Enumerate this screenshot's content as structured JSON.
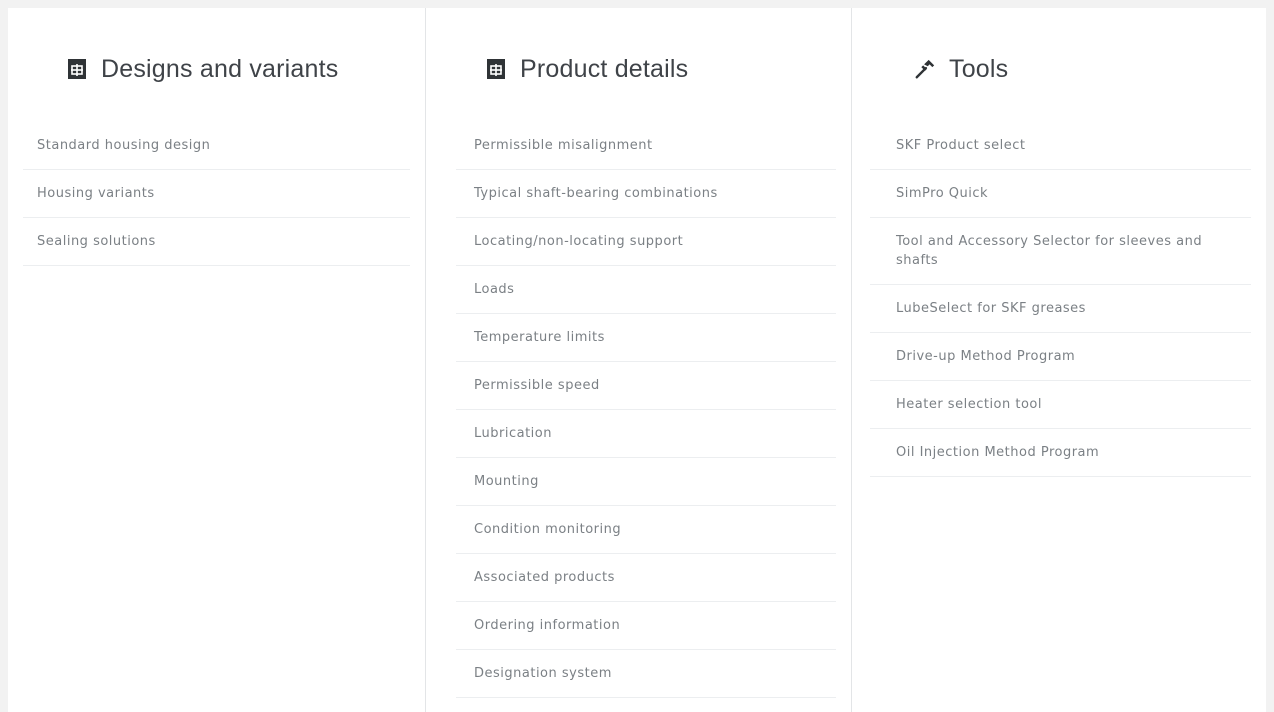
{
  "columns": [
    {
      "title": "Designs and variants",
      "icon": "document-icon",
      "items": [
        {
          "label": "Standard housing design"
        },
        {
          "label": "Housing variants"
        },
        {
          "label": "Sealing solutions"
        }
      ]
    },
    {
      "title": "Product details",
      "icon": "document-icon",
      "items": [
        {
          "label": "Permissible misalignment"
        },
        {
          "label": "Typical shaft-bearing combinations"
        },
        {
          "label": "Locating/non-locating support"
        },
        {
          "label": "Loads"
        },
        {
          "label": "Temperature limits"
        },
        {
          "label": "Permissible speed"
        },
        {
          "label": "Lubrication"
        },
        {
          "label": "Mounting"
        },
        {
          "label": "Condition monitoring"
        },
        {
          "label": "Associated products"
        },
        {
          "label": "Ordering information"
        },
        {
          "label": "Designation system"
        }
      ]
    },
    {
      "title": "Tools",
      "icon": "hammer-icon",
      "items": [
        {
          "label": "SKF Product select"
        },
        {
          "label": "SimPro Quick"
        },
        {
          "label": "Tool and Accessory Selector for sleeves and shafts"
        },
        {
          "label": "LubeSelect for SKF greases"
        },
        {
          "label": "Drive-up Method Program"
        },
        {
          "label": "Heater selection tool"
        },
        {
          "label": "Oil Injection Method Program"
        }
      ]
    }
  ],
  "colors": {
    "heading": "#3f4348",
    "text": "#7b8085",
    "divider": "#eceef0",
    "icon": "#2f3336"
  }
}
